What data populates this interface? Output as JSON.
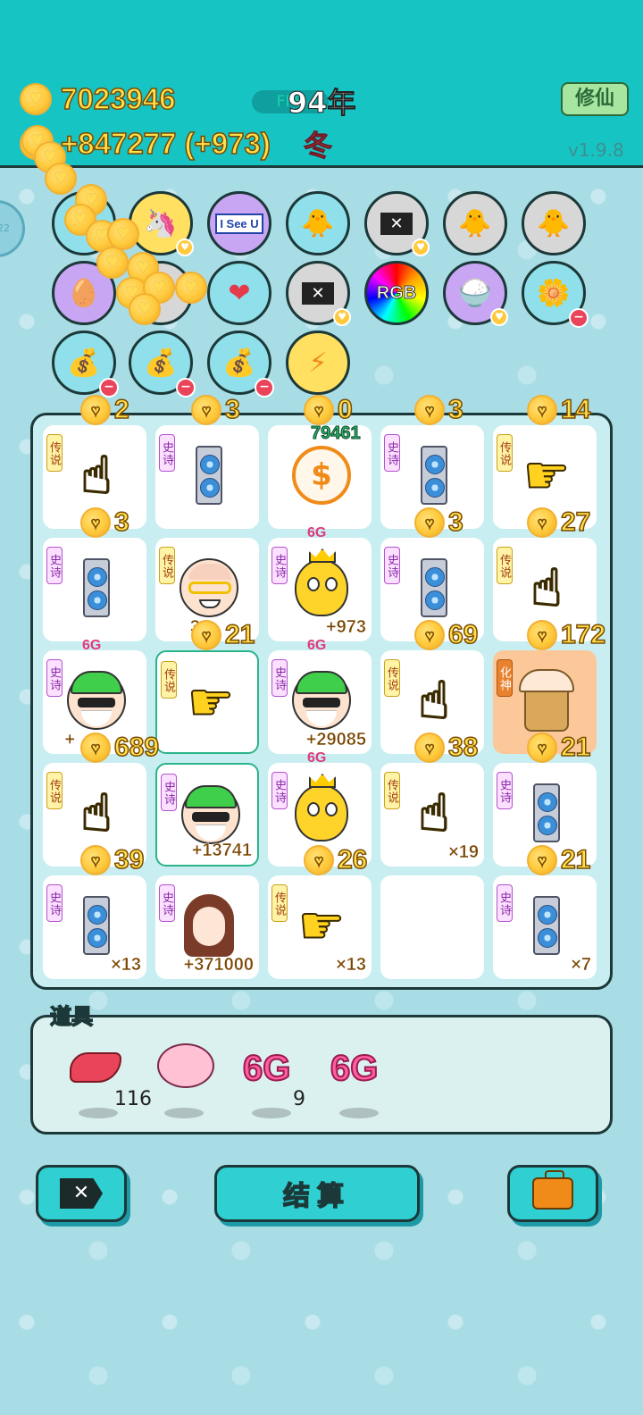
{
  "header": {
    "money": "7023946",
    "income": "+847277 (+973)",
    "fps_label": "FPS",
    "year": "94年",
    "season": "冬",
    "cultivate_label": "修仙",
    "version": "v1.9.8",
    "side_counter": "22"
  },
  "rings": [
    {
      "name": "unicorn",
      "label": "🦄"
    },
    {
      "name": "i-see-u",
      "label": "I See U"
    },
    {
      "name": "chick-egg",
      "label": "🐥"
    },
    {
      "name": "delete-tag",
      "label": "✕"
    },
    {
      "name": "chick-egg-2",
      "label": "🐥"
    },
    {
      "name": "chick-egg-3",
      "label": "🐥"
    },
    {
      "name": "egg-face",
      "label": "🥚"
    },
    {
      "name": "heart-fan",
      "label": "❤"
    },
    {
      "name": "delete-tag-2",
      "label": "✕"
    },
    {
      "name": "rgb",
      "label": "RGB"
    },
    {
      "name": "rice-bowl",
      "label": "🍚"
    },
    {
      "name": "flower-pot",
      "label": "🌼"
    },
    {
      "name": "money-bag-1",
      "label": "💰"
    },
    {
      "name": "money-bag-2",
      "label": "💰"
    },
    {
      "name": "money-bag-3",
      "label": "💰"
    },
    {
      "name": "lightning",
      "label": "⚡"
    }
  ],
  "column_coins": [
    "2",
    "3",
    "0",
    "3",
    "14"
  ],
  "top_value": "79461",
  "tags": {
    "legend": "传说",
    "epic": "史诗",
    "huashen": "化神"
  },
  "cells": [
    {
      "coin": "3",
      "value": ""
    },
    {
      "coin": "",
      "value": ""
    },
    {
      "coin": "",
      "value": ""
    },
    {
      "coin": "3",
      "value": ""
    },
    {
      "coin": "27",
      "value": ""
    },
    {
      "coin": "",
      "value": ""
    },
    {
      "coin": "21",
      "value": "3"
    },
    {
      "coin": "",
      "value": "+973",
      "gtag": "6G"
    },
    {
      "coin": "69",
      "value": ""
    },
    {
      "coin": "172",
      "value": ""
    },
    {
      "coin": "689",
      "value": "+",
      "gtag": "6G"
    },
    {
      "coin": "",
      "value": ""
    },
    {
      "coin": "",
      "value": "+29085",
      "gtag": "6G"
    },
    {
      "coin": "38",
      "value": ""
    },
    {
      "coin": "21",
      "value": ""
    },
    {
      "coin": "39",
      "value": ""
    },
    {
      "coin": "",
      "value": "+13741"
    },
    {
      "coin": "26",
      "value": "",
      "gtag": "6G"
    },
    {
      "coin": "",
      "value": "×19"
    },
    {
      "coin": "21",
      "value": ""
    },
    {
      "coin": "",
      "value": "×13"
    },
    {
      "coin": "",
      "value": "+371000"
    },
    {
      "coin": "",
      "value": "×13"
    },
    {
      "coin": "",
      "value": ""
    },
    {
      "coin": "",
      "value": "×7"
    }
  ],
  "items": {
    "title": "道具",
    "liver_qty": "116",
    "gpu_6g_qty": "9",
    "six_g_left": "6",
    "six_g_right": "G"
  },
  "buttons": {
    "settle_label": "结算"
  },
  "colors": {
    "header_bg": "#17c4c4",
    "board_bg": "#c8eef2",
    "accent_gold": "#ffe04d",
    "button_teal": "#2fcfd2"
  }
}
